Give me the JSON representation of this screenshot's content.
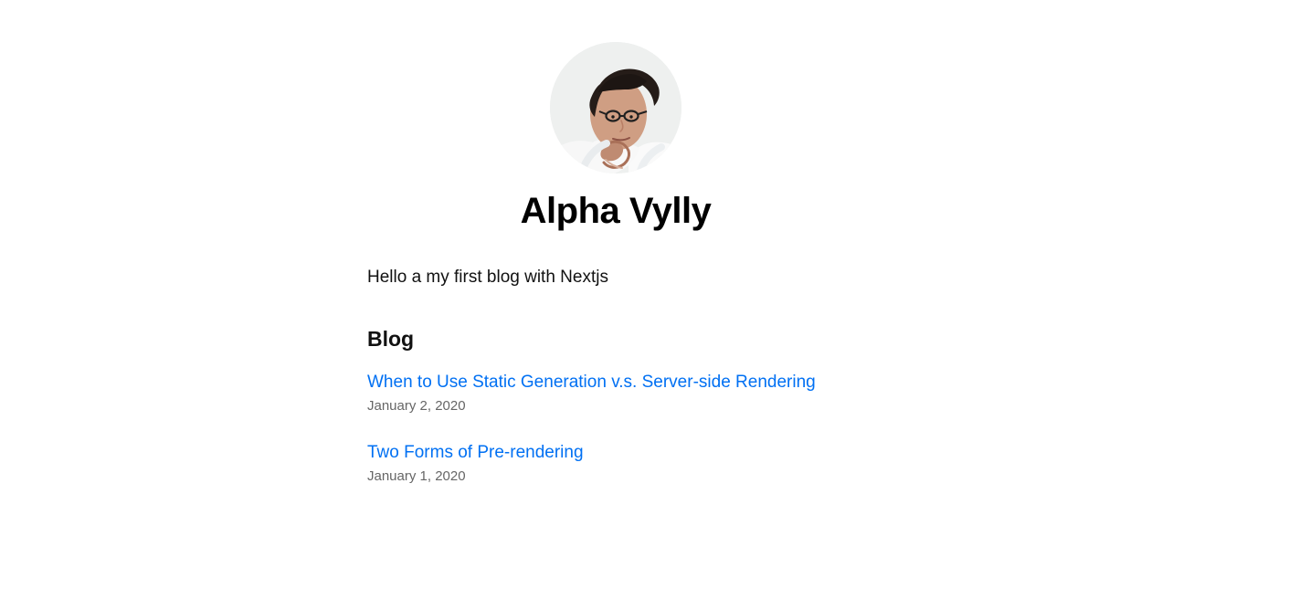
{
  "profile": {
    "name": "Alpha Vylly",
    "avatar_icon": "profile-photo"
  },
  "intro": {
    "text": "Hello a my first blog with Nextjs"
  },
  "blog": {
    "heading": "Blog",
    "posts": [
      {
        "title": "When to Use Static Generation v.s. Server-side Rendering",
        "date": "January 2, 2020"
      },
      {
        "title": "Two Forms of Pre-rendering",
        "date": "January 1, 2020"
      }
    ]
  },
  "colors": {
    "background": "#ffffff",
    "text": "#111111",
    "link": "#0070f3",
    "muted": "#666666"
  }
}
